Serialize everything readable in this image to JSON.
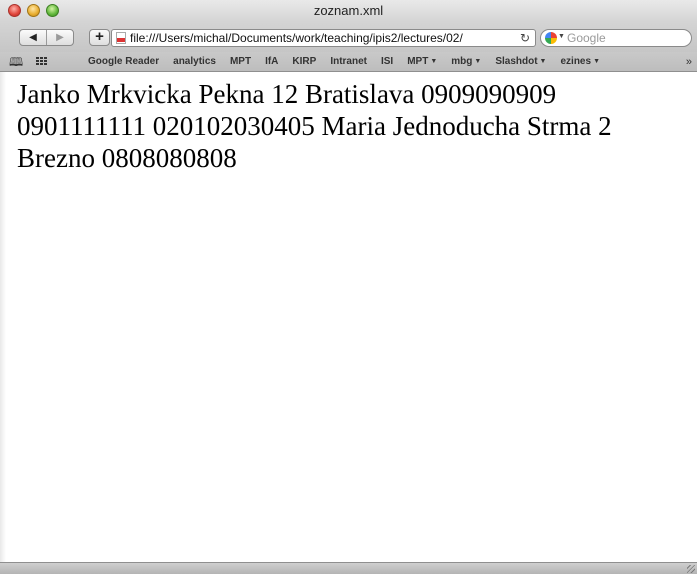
{
  "window": {
    "title": "zoznam.xml"
  },
  "toolbar": {
    "back_label": "◀",
    "forward_label": "▶",
    "add_label": "+",
    "address_value": "file:///Users/michal/Documents/work/teaching/ipis2/lectures/02/",
    "reload_label": "↻",
    "search_placeholder": "Google"
  },
  "bookmarks": {
    "items": [
      {
        "label": "Google Reader",
        "has_menu": false
      },
      {
        "label": "analytics",
        "has_menu": false
      },
      {
        "label": "MPT",
        "has_menu": false
      },
      {
        "label": "IfA",
        "has_menu": false
      },
      {
        "label": "KIRP",
        "has_menu": false
      },
      {
        "label": "Intranet",
        "has_menu": false
      },
      {
        "label": "ISI",
        "has_menu": false
      },
      {
        "label": "MPT",
        "has_menu": true
      },
      {
        "label": "mbg",
        "has_menu": true
      },
      {
        "label": "Slashdot",
        "has_menu": true
      },
      {
        "label": "ezines",
        "has_menu": true
      }
    ],
    "more_label": "»",
    "caret": "▼"
  },
  "content": {
    "text": "Janko Mrkvicka Pekna 12 Bratislava 0909090909 0901111111 020102030405 Maria Jednoducha Strma 2 Brezno 0808080808"
  },
  "icons": {
    "bookmarks_book": "book-icon",
    "bookmarks_grid": "grid-icon",
    "file": "file-icon",
    "google": "google-logo-icon",
    "reload": "reload-icon"
  }
}
